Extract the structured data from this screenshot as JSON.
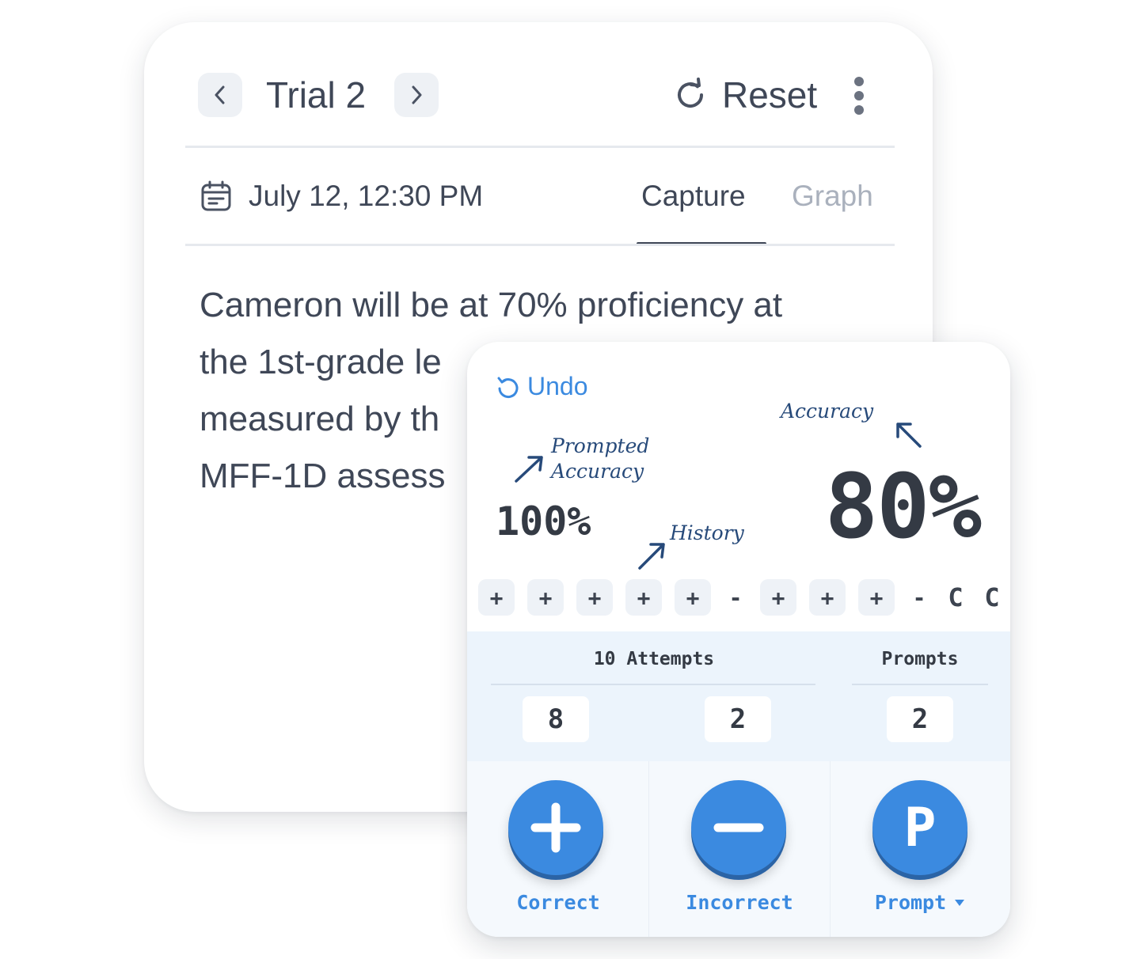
{
  "header": {
    "title": "Trial 2",
    "reset_label": "Reset"
  },
  "session": {
    "date": "July 12, 12:30 PM"
  },
  "tabs": [
    {
      "label": "Capture",
      "active": true
    },
    {
      "label": "Graph",
      "active": false
    }
  ],
  "goal": {
    "lines": [
      "Cameron will be at 70% proficiency at",
      "the 1st-grade le",
      "measured by th",
      "MFF-1D assess"
    ]
  },
  "tracker": {
    "undo_label": "Undo",
    "annotations": {
      "prompted_accuracy": [
        "Prompted",
        "Accuracy"
      ],
      "accuracy": "Accuracy",
      "history": "History"
    },
    "prompted_accuracy_value": "100%",
    "accuracy_value": "80%",
    "history": [
      "+",
      "+",
      "+",
      "+",
      "+",
      "-",
      "+",
      "+",
      "+",
      "-",
      "C",
      "C"
    ],
    "attempts_label": "10 Attempts",
    "prompts_label": "Prompts",
    "counts": {
      "correct": "8",
      "incorrect": "2",
      "prompts": "2"
    },
    "buttons": {
      "correct_label": "Correct",
      "incorrect_label": "Incorrect",
      "prompt_label": "Prompt",
      "prompt_glyph": "P"
    }
  },
  "colors": {
    "accent": "#3b8ae0",
    "text": "#3f4757",
    "muted": "#aab1bd",
    "annotation": "#274a7a"
  }
}
